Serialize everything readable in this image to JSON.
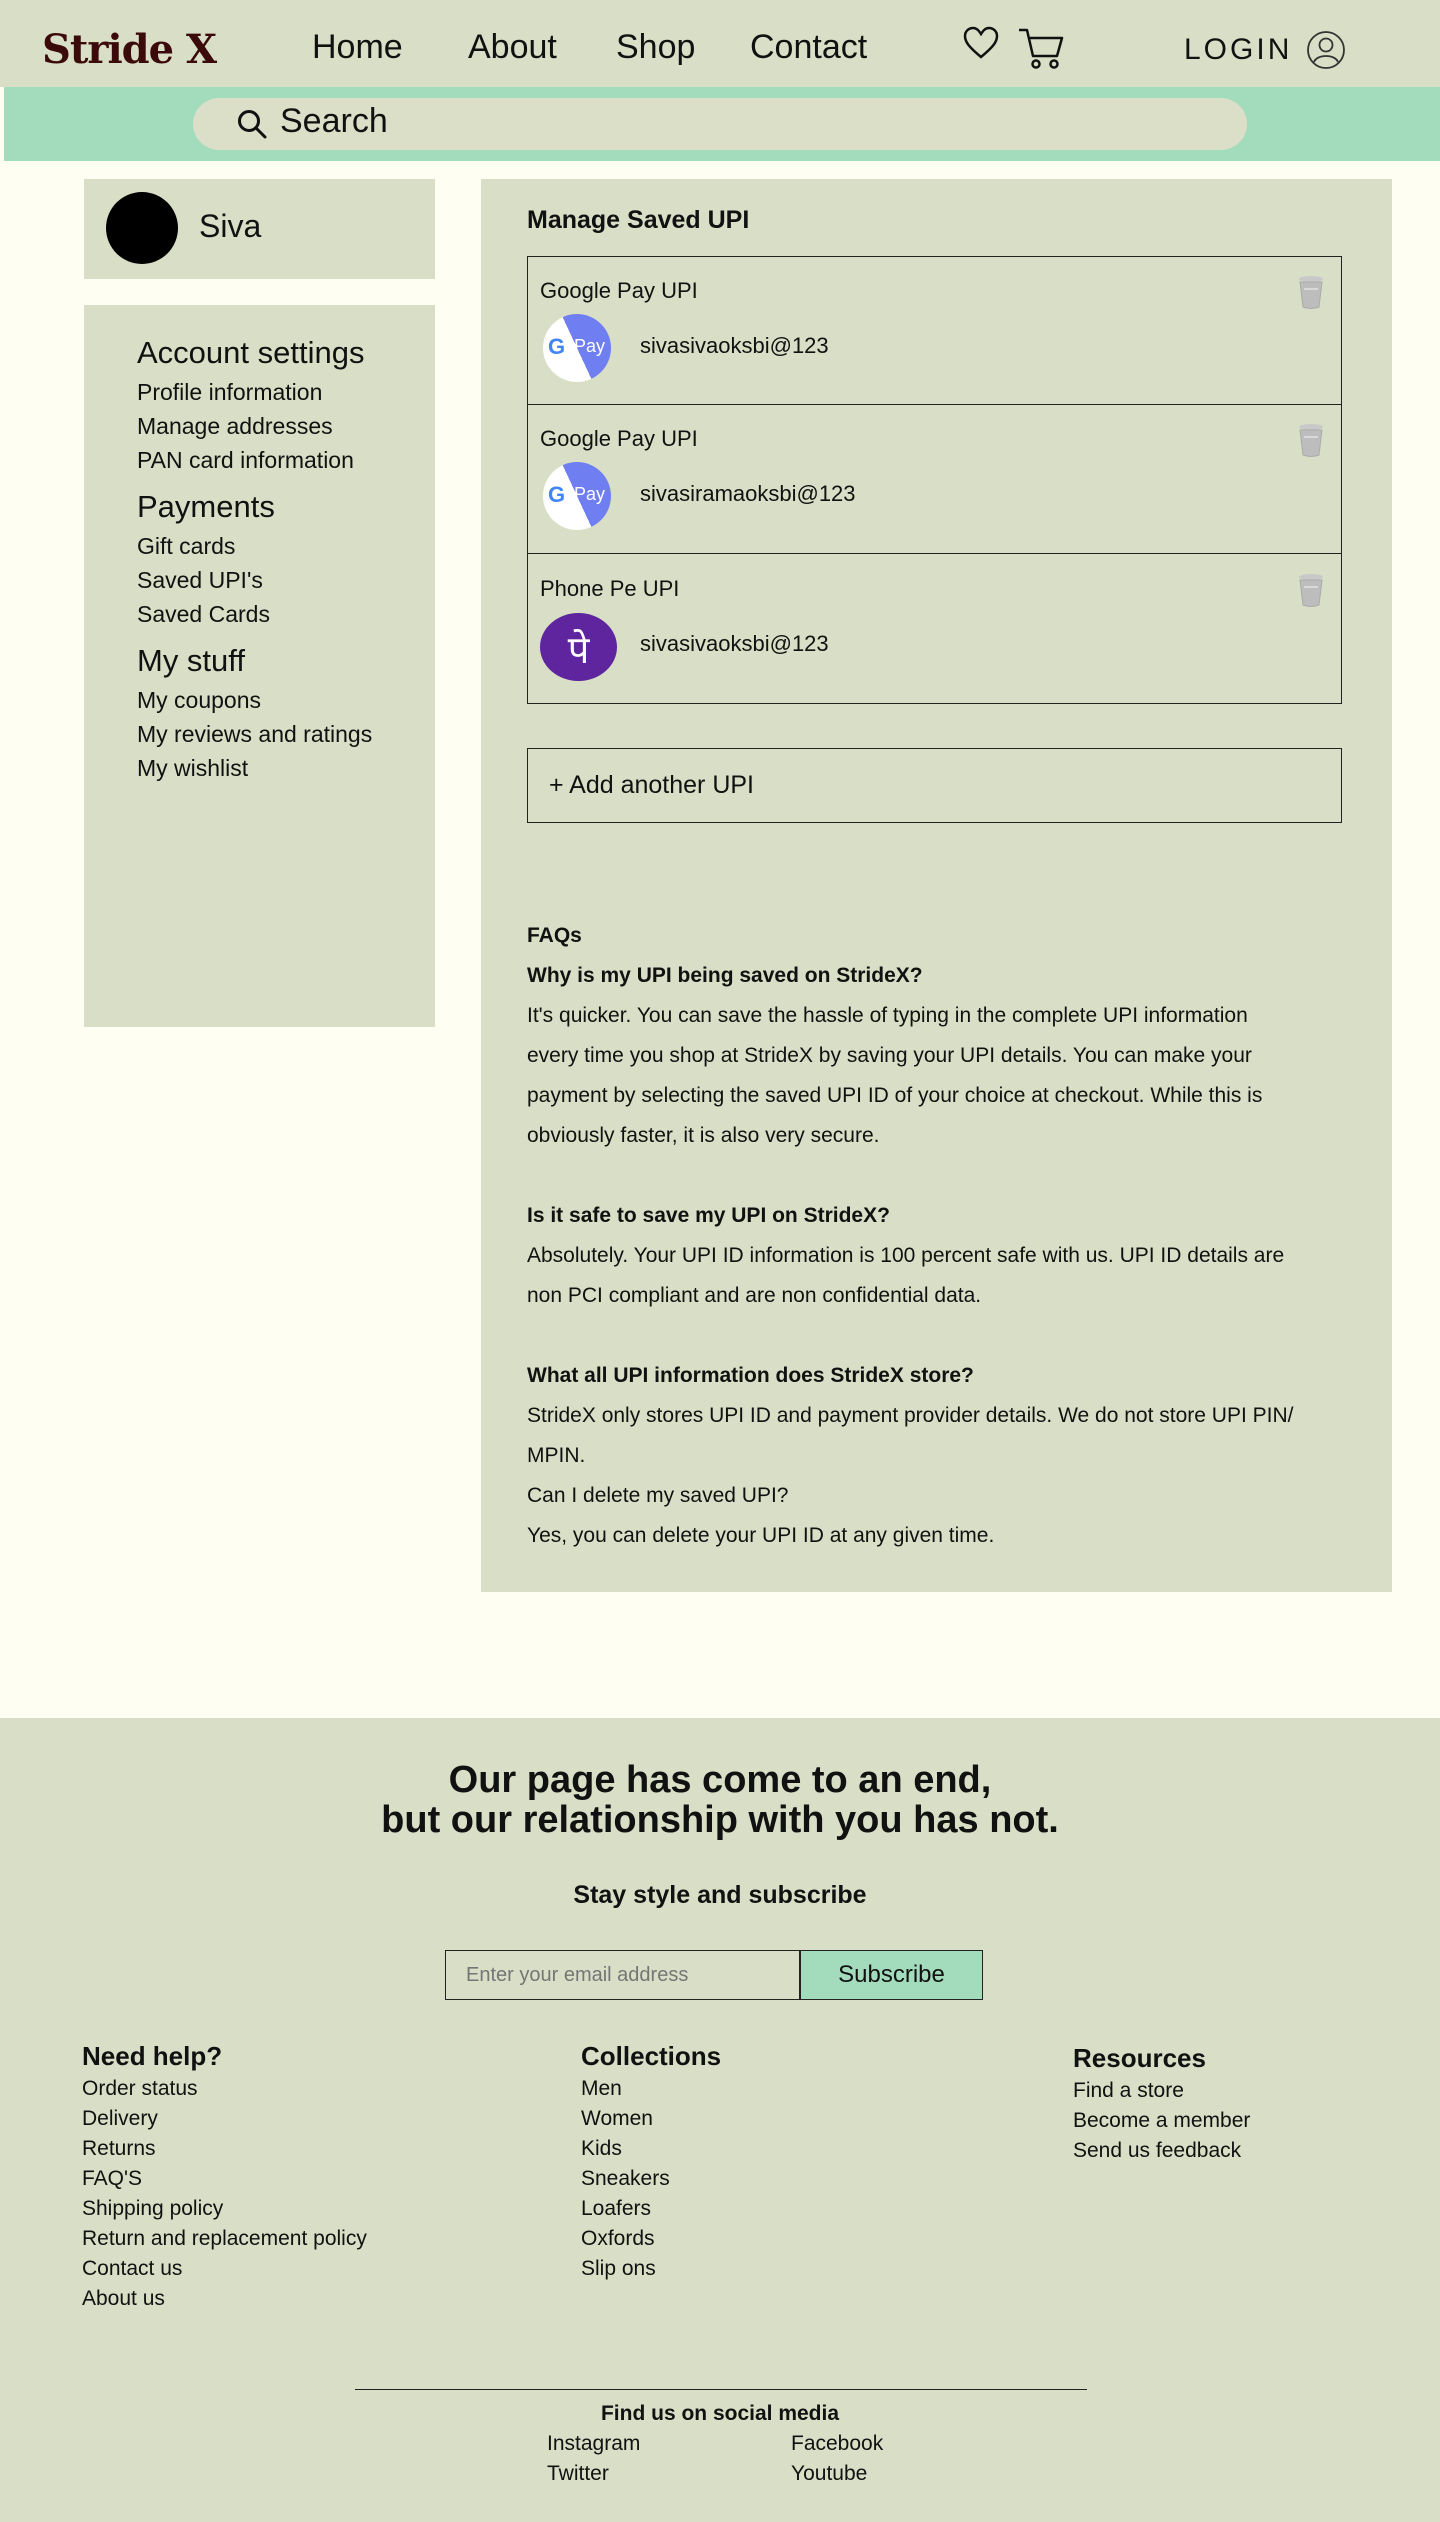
{
  "header": {
    "logo": "Stride X",
    "nav": [
      "Home",
      "About",
      "Shop",
      "Contact"
    ],
    "login_label": "LOGIN",
    "search_placeholder": "Search"
  },
  "user": {
    "name": "Siva"
  },
  "sidebar": {
    "sections": [
      {
        "title": "Account settings",
        "items": [
          "Profile information",
          "Manage addresses",
          "PAN card information"
        ]
      },
      {
        "title": "Payments",
        "items": [
          "Gift cards",
          "Saved UPI's",
          "Saved Cards"
        ]
      },
      {
        "title": "My stuff",
        "items": [
          "My coupons",
          "My reviews and ratings",
          "My wishlist"
        ]
      }
    ]
  },
  "upi": {
    "title": "Manage Saved UPI",
    "entries": [
      {
        "type": "Google Pay UPI",
        "id": "sivasivaoksbi@123",
        "logo_text": "Pay"
      },
      {
        "type": "Google Pay UPI",
        "id": "sivasiramaoksbi@123",
        "logo_text": "Pay"
      },
      {
        "type": "Phone Pe UPI",
        "id": "sivasivaoksbi@123",
        "logo_text": "पे"
      }
    ],
    "add_label": "+ Add another UPI"
  },
  "faq": {
    "heading": "FAQs",
    "q1": "Why is my UPI being saved on StrideX?",
    "a1": [
      "It's quicker. You can save the hassle of typing in the complete UPI information",
      "every time you shop at StrideX by saving your UPI details. You can make your",
      "payment by selecting the saved UPI ID of your choice at checkout. While this is",
      "obviously faster, it is also very secure."
    ],
    "q2": "Is it safe to save my UPI on StrideX?",
    "a2": [
      "Absolutely. Your UPI ID information is 100 percent safe with us. UPI ID details are",
      "non PCI compliant and are non confidential data."
    ],
    "q3": "What all UPI information does StrideX store?",
    "a3": [
      "StrideX only stores UPI ID and payment provider details. We do not store UPI PIN/",
      "MPIN.",
      "Can I delete my saved UPI?",
      "Yes, you can delete your UPI ID at any given time."
    ]
  },
  "footer": {
    "headline_1": "Our page has come to an end,",
    "headline_2": "but our relationship with you has not.",
    "subscribe_title": "Stay style and subscribe",
    "email_placeholder": "Enter your email address",
    "subscribe_button": "Subscribe",
    "cols": [
      {
        "title": "Need help?",
        "items": [
          "Order status",
          "Delivery",
          "Returns",
          "FAQ'S",
          "Shipping policy",
          "Return and replacement policy",
          "Contact us",
          "About us"
        ]
      },
      {
        "title": "Collections",
        "items": [
          "Men",
          "Women",
          "Kids",
          "Sneakers",
          "Loafers",
          "Oxfords",
          "Slip ons"
        ]
      },
      {
        "title": "Resources",
        "items": [
          "Find a store",
          "Become a member",
          "Send us feedback"
        ]
      }
    ],
    "social_title": "Find us on social media",
    "social": [
      "Instagram",
      "Facebook",
      "Twitter",
      "Youtube"
    ]
  },
  "colors": {
    "header_bg": "#d9dfc6",
    "accent": "#a3dcbc",
    "page_bg": "#fffef2",
    "logo": "#3b0a0a",
    "phonepe": "#5f259f",
    "gpay": "#6f7ef0"
  },
  "icons": [
    "search-icon",
    "heart-icon",
    "cart-icon",
    "user-icon",
    "trash-icon"
  ]
}
